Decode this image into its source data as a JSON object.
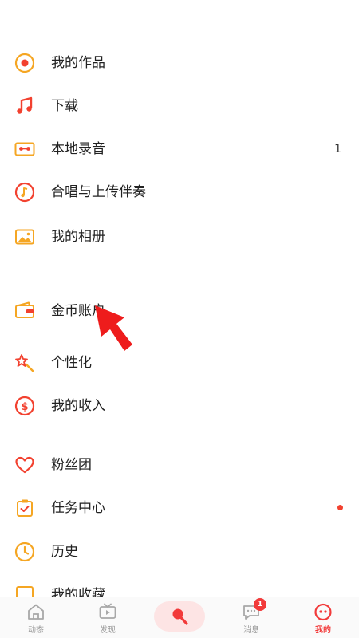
{
  "menu": {
    "items": [
      {
        "label": "我的作品",
        "icon": "vinyl-record-icon"
      },
      {
        "label": "下载",
        "icon": "music-note-icon"
      },
      {
        "label": "本地录音",
        "icon": "cassette-tape-icon",
        "count": "1"
      },
      {
        "label": "合唱与上传伴奏",
        "icon": "music-disc-icon"
      },
      {
        "label": "我的相册",
        "icon": "photo-album-icon"
      },
      {
        "label": "金币账户",
        "icon": "wallet-icon"
      },
      {
        "label": "个性化",
        "icon": "magic-wand-icon"
      },
      {
        "label": "我的收入",
        "icon": "dollar-coin-icon"
      },
      {
        "label": "粉丝团",
        "icon": "heart-icon"
      },
      {
        "label": "任务中心",
        "icon": "clipboard-icon",
        "has_dot": true
      },
      {
        "label": "历史",
        "icon": "clock-icon"
      },
      {
        "label": "我的收藏",
        "icon": "star-box-icon"
      }
    ]
  },
  "tabbar": {
    "tabs": [
      {
        "label": "动态",
        "icon": "home-icon"
      },
      {
        "label": "发现",
        "icon": "tv-icon"
      },
      {
        "label": "",
        "icon": "microphone-icon"
      },
      {
        "label": "消息",
        "icon": "message-bubble-icon",
        "badge": "1"
      },
      {
        "label": "我的",
        "icon": "profile-face-icon",
        "active": true
      }
    ]
  },
  "colors": {
    "accent_red": "#f23a3a",
    "icon_orange": "#f5a623",
    "icon_red": "#f2412f"
  }
}
